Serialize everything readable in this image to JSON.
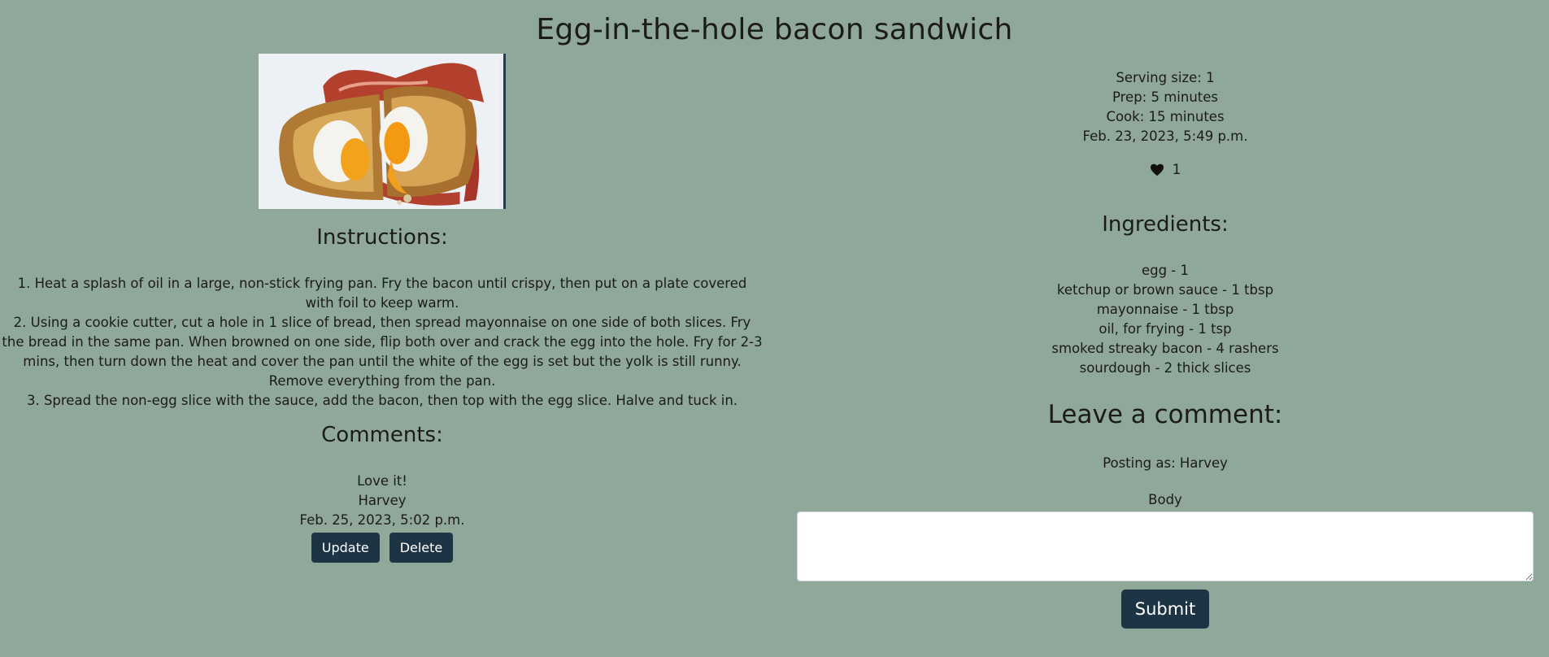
{
  "recipe": {
    "title": "Egg-in-the-hole bacon sandwich",
    "image_alt": "Egg-in-the-hole bacon sandwich"
  },
  "instructions": {
    "heading": "Instructions:",
    "steps": [
      "1. Heat a splash of oil in a large, non-stick frying pan. Fry the bacon until crispy, then put on a plate covered with foil to keep warm.",
      "2. Using a cookie cutter, cut a hole in 1 slice of bread, then spread mayonnaise on one side of both slices. Fry the bread in the same pan. When browned on one side, flip both over and crack the egg into the hole. Fry for 2-3 mins, then turn down the heat and cover the pan until the white of the egg is set but the yolk is still runny. Remove everything from the pan.",
      "3. Spread the non-egg slice with the sauce, add the bacon, then top with the egg slice. Halve and tuck in."
    ]
  },
  "comments": {
    "heading": "Comments:",
    "items": [
      {
        "body": "Love it!",
        "author": "Harvey",
        "date": "Feb. 25, 2023, 5:02 p.m.",
        "update_label": "Update",
        "delete_label": "Delete"
      }
    ]
  },
  "meta": {
    "serving_size": "Serving size: 1",
    "prep": "Prep: 5 minutes",
    "cook": "Cook: 15 minutes",
    "created": "Feb. 23, 2023, 5:49 p.m.",
    "like_icon": "heart-icon",
    "like_count": "1"
  },
  "ingredients": {
    "heading": "Ingredients:",
    "items": [
      "egg - 1",
      "ketchup or brown sauce - 1 tbsp",
      "mayonnaise - 1 tbsp",
      "oil, for frying - 1 tsp",
      "smoked streaky bacon - 4 rashers",
      "sourdough - 2 thick slices"
    ]
  },
  "comment_form": {
    "heading": "Leave a comment:",
    "posting_as": "Posting as: Harvey",
    "body_label": "Body",
    "body_value": "",
    "submit_label": "Submit"
  },
  "colors": {
    "background": "#8fa89a",
    "button": "#1d3444",
    "text": "#1b1b1b"
  }
}
